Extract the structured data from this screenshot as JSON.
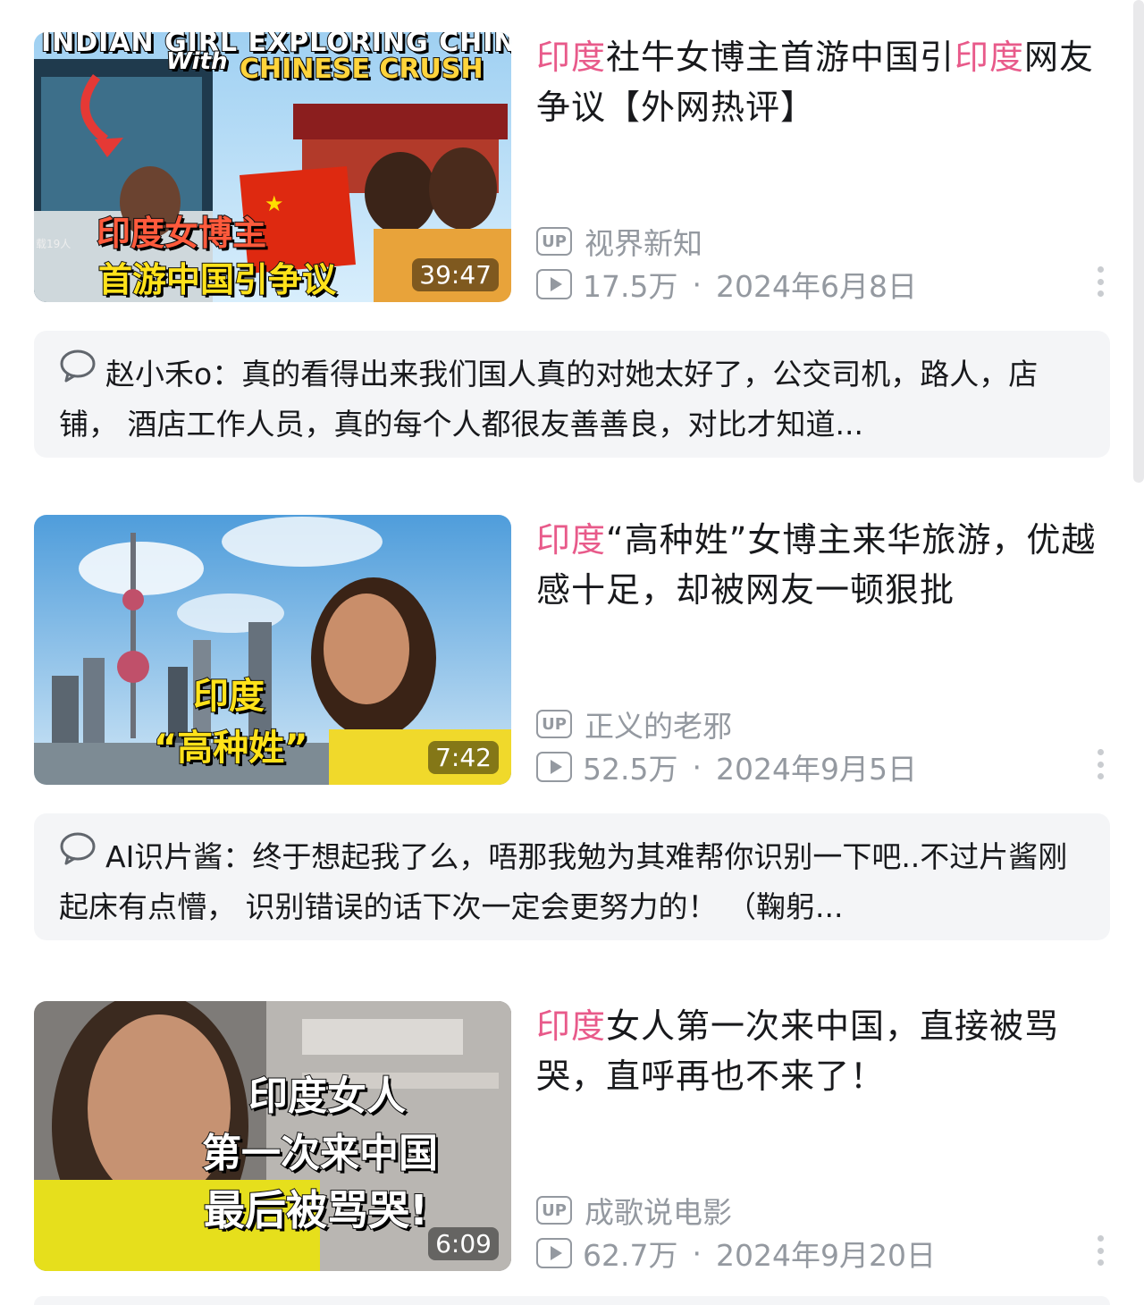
{
  "colors": {
    "highlight": "#e85a8a",
    "meta": "#9499a0",
    "comment_bg": "#f4f5f7"
  },
  "videos": [
    {
      "title_hl": "印度",
      "title_mid": "社牛女博主首游中国引",
      "title_hl2": "印度",
      "title_rest": "网友争议【外网热评】",
      "uploader": "视界新知",
      "views": "17.5万",
      "date": "2024年6月8日",
      "duration": "39:47",
      "thumb_caption_top": "INDIAN GIRL EXPLORING CHINA",
      "thumb_caption_with": "With",
      "thumb_caption_en": "CHINESE CRUSH",
      "thumb_caption_1": "印度女博主",
      "thumb_caption_2": "首游中国引争议",
      "thumb_bus_text": "载19人",
      "comment": {
        "user": "赵小禾o",
        "text": "真的看得出来我们国人真的对她太好了，公交司机，路人，店铺， 酒店工作人员，真的每个人都很友善善良，对比才知道..."
      }
    },
    {
      "title_hl": "印度",
      "title_rest": "“高种姓”女博主来华旅游，优越感十足，却被网友一顿狠批",
      "uploader": "正义的老邪",
      "views": "52.5万",
      "date": "2024年9月5日",
      "duration": "7:42",
      "thumb_caption_1": "印度",
      "thumb_caption_2": "“高种姓”",
      "comment": {
        "user": "AI识片酱",
        "text": "终于想起我了么，唔那我勉为其难帮你识别一下吧..不过片酱刚起床有点懵， 识别错误的话下次一定会更努力的！ （鞠躬..."
      }
    },
    {
      "title_hl": "印度",
      "title_rest": "女人第一次来中国，直接被骂哭，直呼再也不来了！",
      "uploader": "成歌说电影",
      "views": "62.7万",
      "date": "2024年9月20日",
      "duration": "6:09",
      "thumb_caption_1": "印度女人",
      "thumb_caption_2": "第一次来中国",
      "thumb_caption_3": "最后被骂哭!"
    }
  ],
  "icons": {
    "up_badge": "UP",
    "play": "play-count-icon",
    "comment": "comment-bubble-icon",
    "more": "more-vertical-icon"
  }
}
